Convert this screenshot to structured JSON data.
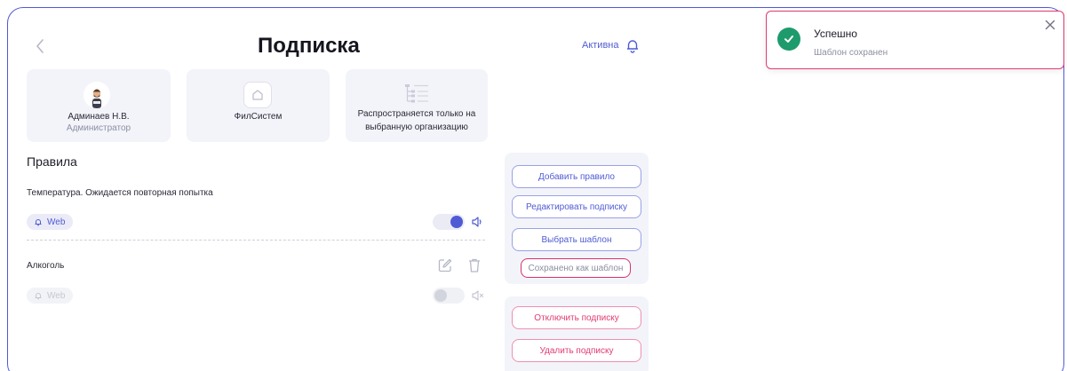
{
  "page": {
    "title": "Подписка",
    "status_label": "Активна"
  },
  "cards": {
    "user": {
      "name": "Админаев Н.В.",
      "role": "Администратор"
    },
    "org": {
      "name": "ФилСистем"
    },
    "scope": {
      "line1": "Распространяется только на",
      "line2": "выбранную организацию"
    }
  },
  "rules": {
    "section_title": "Правила",
    "items": [
      {
        "name": "Температура. Ожидается повторная попытка",
        "channel": "Web",
        "enabled": true,
        "sound": "on"
      },
      {
        "name": "Алкоголь",
        "channel": "Web",
        "enabled": false,
        "sound": "muted"
      }
    ]
  },
  "actions": {
    "add_rule": "Добавить правило",
    "edit_subscription": "Редактировать подписку",
    "choose_template": "Выбрать шаблон",
    "saved_as_template": "Сохранено как шаблон",
    "disable_subscription": "Отключить подписку",
    "delete_subscription": "Удалить подписку"
  },
  "toast": {
    "title": "Успешно",
    "message": "Шаблон сохранен"
  },
  "colors": {
    "accent": "#4f5bd5",
    "danger": "#e23a73",
    "success": "#1e9b6c",
    "panel": "#f3f4fa"
  },
  "icons": {
    "back": "chevron-left-icon",
    "status": "bell-icon",
    "org": "home-icon",
    "scope": "tree-list-icon",
    "channel": "bell-icon",
    "sound_on": "speaker-icon",
    "sound_off": "speaker-muted-icon",
    "edit": "edit-icon",
    "delete": "trash-icon",
    "toast_success": "check-circle-icon",
    "toast_close": "close-icon"
  }
}
